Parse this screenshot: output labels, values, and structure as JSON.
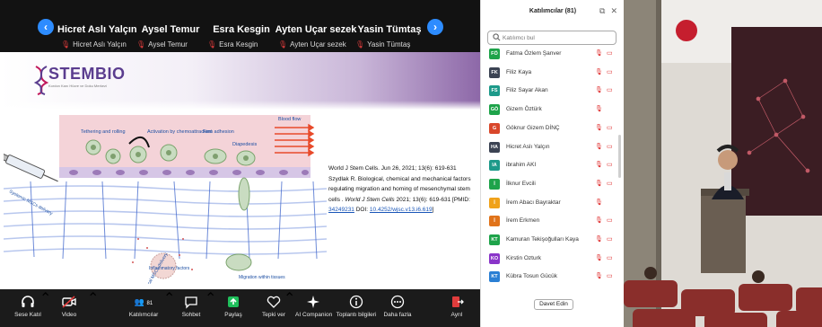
{
  "gallery": {
    "participants": [
      {
        "name": "Hicret Aslı Yalçın"
      },
      {
        "name": "Aysel Temur"
      },
      {
        "name": "Esra Kesgin"
      },
      {
        "name": "Ayten Uçar sezek"
      },
      {
        "name": "Yasin Tümtaş"
      }
    ]
  },
  "slide": {
    "logo_text": "STEMBIO",
    "logo_subtitle": "Kordon Kanı Hücre ve Doku Merkezi",
    "diagram_labels": {
      "tethering": "Tethering and rolling",
      "activation": "Activation by chemoattractant",
      "firm": "Firm adhesion",
      "diapedesis": "Diapedesis",
      "bloodflow": "Blood flow",
      "systemic": "Systemic MSCs delivery",
      "inflammatory": "Inflammatory factors",
      "migration": "Migration within tissues",
      "local": "Local MSCs delivery"
    },
    "citation": {
      "line1": "World J Stem Cells. Jun 26, 2021; 13(6): 619-631",
      "line2": "Szydlak R. Biological, chemical and mechanical factors regulating migration and homing of mesenchymal stem cells . ",
      "journal": "World J Stem Cells",
      "line3": " 2021; 13(6): 619-631 [PMID: ",
      "pmid": "34249231",
      "line4": " DOI: ",
      "doi": "10.4252/wjsc.v13.i6.619",
      "line5": "]"
    }
  },
  "toolbar": {
    "audio": "Sese Katıl",
    "video": "Video",
    "participants": "Katılımcılar",
    "participants_count": "81",
    "chat": "Sohbet",
    "share": "Paylaş",
    "react": "Tepki ver",
    "ai": "AI Companion",
    "info": "Toplantı bilgileri",
    "more": "Daha fazla",
    "leave": "Ayrıl"
  },
  "panel": {
    "title": "Katılımcılar (81)",
    "search_placeholder": "Katılımcı bul",
    "invite": "Davet Edin",
    "participants": [
      {
        "initials": "FÖ",
        "name": "Fatma Özlem Şanver",
        "color": "#1ea34a",
        "cam": true
      },
      {
        "initials": "FK",
        "name": "Filiz Kaya",
        "color": "#3b4353",
        "cam": true
      },
      {
        "initials": "FS",
        "name": "Filiz Sayar Akan",
        "color": "#1d9a8a",
        "cam": true
      },
      {
        "initials": "GÖ",
        "name": "Gizem Öztürk",
        "color": "#1ea34a",
        "cam": false
      },
      {
        "initials": "G",
        "name": "Göknur Gizem DİNÇ",
        "color": "#d9472b",
        "cam": true
      },
      {
        "initials": "HA",
        "name": "Hicret Aslı Yalçın",
        "color": "#3b4353",
        "cam": true
      },
      {
        "initials": "IA",
        "name": "ibrahim AKI",
        "color": "#1d9a8a",
        "cam": true
      },
      {
        "initials": "İ",
        "name": "İlknur Evcili",
        "color": "#1ea34a",
        "cam": true
      },
      {
        "initials": "İ",
        "name": "İrem Abacı Bayraktar",
        "color": "#f0a21a",
        "cam": false
      },
      {
        "initials": "İ",
        "name": "İrem Erkmen",
        "color": "#e0731a",
        "cam": true
      },
      {
        "initials": "KT",
        "name": "Kamuran Tekişoğulları Kaya",
        "color": "#1ea34a",
        "cam": true
      },
      {
        "initials": "KO",
        "name": "Kirstin Ozturk",
        "color": "#8a35c9",
        "cam": true
      },
      {
        "initials": "KT",
        "name": "Kübra Tosun Gücük",
        "color": "#2a7fd4",
        "cam": true
      }
    ]
  }
}
